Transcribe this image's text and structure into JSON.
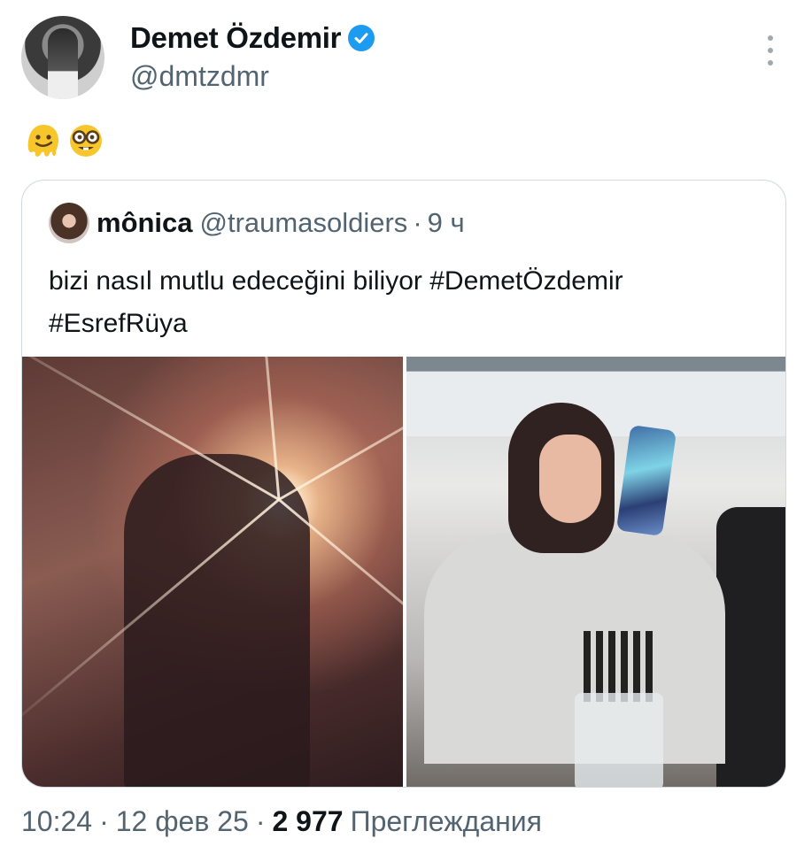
{
  "tweet": {
    "author_name": "Demet Özdemir",
    "author_handle": "@dmtzdmr",
    "verified": true,
    "emojis": [
      "melting-face",
      "nerd-face"
    ],
    "time": "10:24",
    "date": "12 фев 25",
    "views_count": "2 977",
    "views_label": "Преглеждания"
  },
  "quote": {
    "name": "mônica",
    "handle": "@traumasoldiers",
    "dot": "·",
    "time": "9 ч",
    "text_line1_plain": "bizi nasıl mutlu edeceğini biliyor ",
    "hashtag1": "#DemetÖzdemir",
    "hashtag2": "#EsrefRüya"
  },
  "colors": {
    "verified": "#1d9bf0",
    "secondary_text": "#536471",
    "border": "#cfd9de"
  }
}
